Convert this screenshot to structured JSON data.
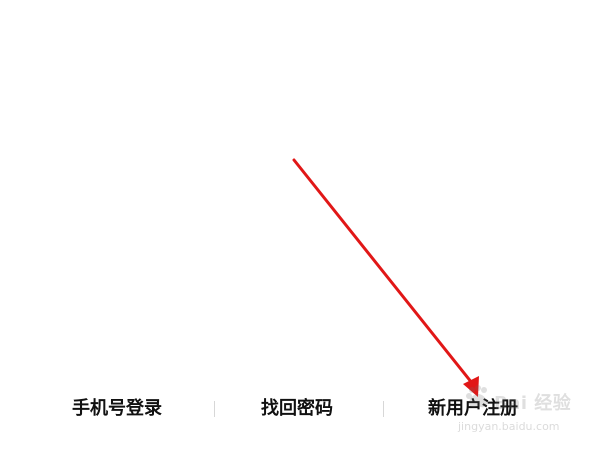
{
  "bottom_links": {
    "login_label": "手机号登录",
    "forgot_label": "找回密码",
    "register_label": "新用户注册"
  },
  "watermark": {
    "main": "Bai 经验",
    "sub": "jingyan.baidu.com"
  },
  "colors": {
    "background": "#ffffff",
    "link_text": "#111111",
    "separator": "#d7d7d7",
    "annotation_arrow": "#e11717"
  },
  "icons": {
    "annotation": "red-arrow-icon",
    "watermark": "paw-icon"
  }
}
